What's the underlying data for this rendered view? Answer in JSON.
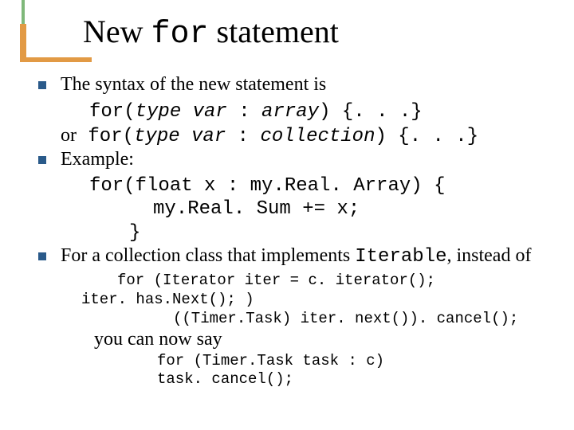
{
  "title": {
    "pre": "New ",
    "code": "for",
    "post": " statement"
  },
  "b1": {
    "lead": "The syntax of the new statement is",
    "l1a": "for(",
    "l1b": "type var ",
    "l1c": ": ",
    "l1d": "array",
    "l1e": ") {. . .}",
    "or": "or",
    "l2a": "   for(",
    "l2b": "type var ",
    "l2c": ": ",
    "l2d": "collection",
    "l2e": ") {. . .}"
  },
  "b2": {
    "lead": "Example:",
    "c1": "for(float x : my.Real. Array) {",
    "c2": "my.Real. Sum += x;",
    "c3": "}"
  },
  "b3": {
    "pre": "For a collection class that implements ",
    "code": "Iterable",
    "post": ", instead of"
  },
  "oldcode": {
    "l1": "for (Iterator iter = c. iterator();",
    "l2": "iter. has.Next(); )",
    "l3": "((Timer.Task) iter. next()). cancel();"
  },
  "say": "you can now say",
  "newcode": {
    "l1": "for (Timer.Task task : c)",
    "l2": "task. cancel();"
  }
}
